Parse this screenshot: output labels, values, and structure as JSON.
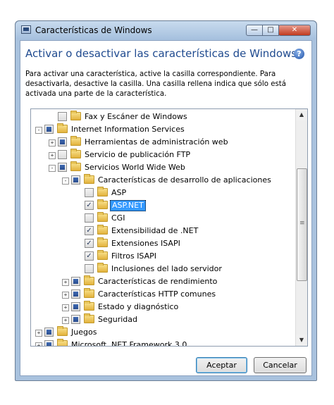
{
  "window": {
    "title": "Características de Windows",
    "controls": {
      "minimize": "—",
      "maximize": "□",
      "close": "✕"
    }
  },
  "heading": "Activar o desactivar las características de Windows",
  "help_icon": "?",
  "description": "Para activar una característica, active la casilla correspondiente. Para desactivarla, desactive la casilla. Una casilla rellena indica que sólo está activada una parte de la característica.",
  "tree": {
    "items": [
      {
        "label": "Fax y Escáner de Windows",
        "level": 1,
        "expander": null,
        "state": "unchecked"
      },
      {
        "label": "Internet Information Services",
        "level": 0,
        "expander": "-",
        "state": "partial"
      },
      {
        "label": "Herramientas de administración web",
        "level": 1,
        "expander": "+",
        "state": "partial"
      },
      {
        "label": "Servicio de publicación FTP",
        "level": 1,
        "expander": "+",
        "state": "unchecked"
      },
      {
        "label": "Servicios World Wide Web",
        "level": 1,
        "expander": "-",
        "state": "partial"
      },
      {
        "label": "Características de desarrollo de aplicaciones",
        "level": 2,
        "expander": "-",
        "state": "partial"
      },
      {
        "label": "ASP",
        "level": 3,
        "expander": null,
        "state": "unchecked"
      },
      {
        "label": "ASP.NET",
        "level": 3,
        "expander": null,
        "state": "checked",
        "selected": true
      },
      {
        "label": "CGI",
        "level": 3,
        "expander": null,
        "state": "unchecked"
      },
      {
        "label": "Extensibilidad de .NET",
        "level": 3,
        "expander": null,
        "state": "checked"
      },
      {
        "label": "Extensiones ISAPI",
        "level": 3,
        "expander": null,
        "state": "checked"
      },
      {
        "label": "Filtros ISAPI",
        "level": 3,
        "expander": null,
        "state": "checked"
      },
      {
        "label": "Inclusiones del lado servidor",
        "level": 3,
        "expander": null,
        "state": "unchecked"
      },
      {
        "label": "Características de rendimiento",
        "level": 2,
        "expander": "+",
        "state": "partial"
      },
      {
        "label": "Características HTTP comunes",
        "level": 2,
        "expander": "+",
        "state": "partial"
      },
      {
        "label": "Estado y diagnóstico",
        "level": 2,
        "expander": "+",
        "state": "partial"
      },
      {
        "label": "Seguridad",
        "level": 2,
        "expander": "+",
        "state": "partial"
      },
      {
        "label": "Juegos",
        "level": 0,
        "expander": "+",
        "state": "partial"
      },
      {
        "label": "Microsoft .NET Framework 3.0",
        "level": 0,
        "expander": "+",
        "state": "partial"
      }
    ],
    "scrollbar": {
      "up": "▲",
      "down": "▼",
      "grip": "≡"
    }
  },
  "buttons": {
    "ok": "Aceptar",
    "cancel": "Cancelar"
  },
  "icons": {
    "window": "window-icon",
    "help": "help-icon",
    "folder": "folder-icon",
    "check": "✓"
  }
}
